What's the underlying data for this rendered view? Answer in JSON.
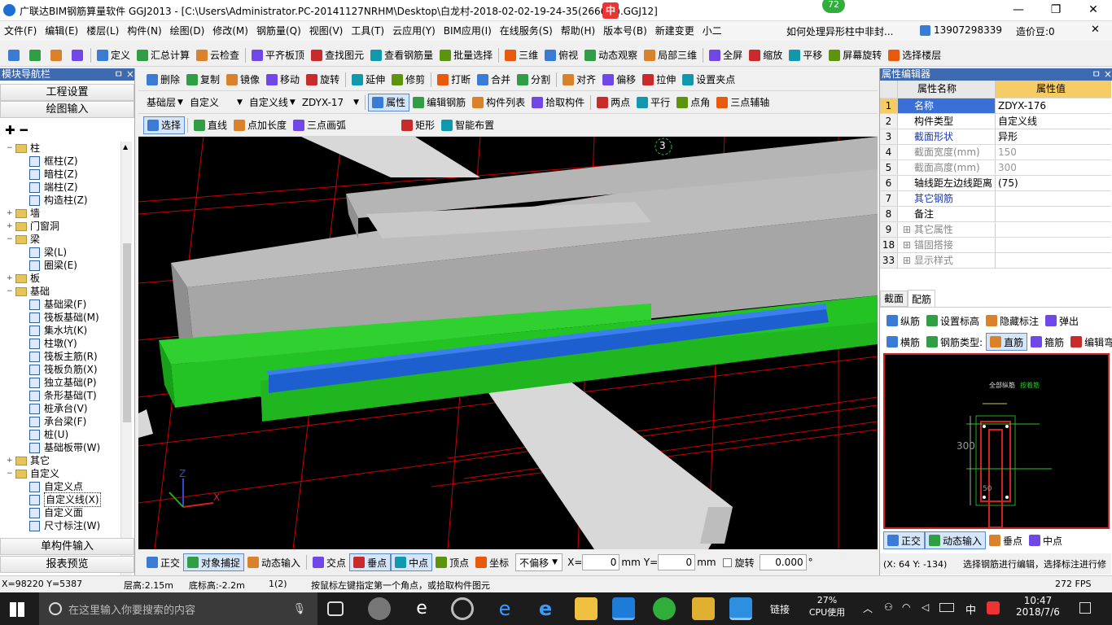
{
  "title": "广联达BIM钢筋算量软件 GGJ2013 - [C:\\Users\\Administrator.PC-20141127NRHM\\Desktop\\白龙村-2018-02-02-19-24-35(2666版).GGJ12]",
  "badge": "72",
  "ime": {
    "label": "中"
  },
  "menu": [
    "文件(F)",
    "编辑(E)",
    "楼层(L)",
    "构件(N)",
    "绘图(D)",
    "修改(M)",
    "钢筋量(Q)",
    "视图(V)",
    "工具(T)",
    "云应用(Y)",
    "BIM应用(I)",
    "在线服务(S)",
    "帮助(H)",
    "版本号(B)",
    "新建变更",
    "小二"
  ],
  "menu_right": {
    "question": "如何处理异形柱中非封...",
    "phone": "13907298339",
    "price": "造价豆:0"
  },
  "toolbar1": [
    "定义",
    "汇总计算",
    "云检查",
    "平齐板顶",
    "查找图元",
    "查看钢筋量",
    "批量选择",
    "三维",
    "俯视",
    "动态观察",
    "局部三维",
    "全屏",
    "缩放",
    "平移",
    "屏幕旋转",
    "选择楼层"
  ],
  "toolbar2": [
    "删除",
    "复制",
    "镜像",
    "移动",
    "旋转",
    "延伸",
    "修剪",
    "打断",
    "合并",
    "分割",
    "对齐",
    "偏移",
    "拉伸",
    "设置夹点"
  ],
  "toolbar3": {
    "layer": "基础层",
    "type": "自定义",
    "subtype": "自定义线",
    "component": "ZDYX-17",
    "buttons": [
      "属性",
      "编辑钢筋",
      "构件列表",
      "拾取构件",
      "两点",
      "平行",
      "点角",
      "三点辅轴"
    ]
  },
  "toolbar4": [
    "选择",
    "直线",
    "点加长度",
    "三点画弧",
    "矩形",
    "智能布置"
  ],
  "left": {
    "header": "模块导航栏",
    "pin": "ㅁ ×",
    "btn1": "工程设置",
    "btn2": "绘图输入",
    "tree": [
      {
        "level": 0,
        "exp": "−",
        "kind": "folder",
        "label": "柱"
      },
      {
        "level": 1,
        "kind": "leaf",
        "label": "框柱(Z)"
      },
      {
        "level": 1,
        "kind": "leaf",
        "label": "暗柱(Z)"
      },
      {
        "level": 1,
        "kind": "leaf",
        "label": "端柱(Z)"
      },
      {
        "level": 1,
        "kind": "leaf",
        "label": "构造柱(Z)"
      },
      {
        "level": 0,
        "exp": "+",
        "kind": "folder",
        "label": "墙"
      },
      {
        "level": 0,
        "exp": "+",
        "kind": "folder",
        "label": "门窗洞"
      },
      {
        "level": 0,
        "exp": "−",
        "kind": "folder",
        "label": "梁"
      },
      {
        "level": 1,
        "kind": "leaf",
        "label": "梁(L)"
      },
      {
        "level": 1,
        "kind": "leaf",
        "label": "圈梁(E)"
      },
      {
        "level": 0,
        "exp": "+",
        "kind": "folder",
        "label": "板"
      },
      {
        "level": 0,
        "exp": "−",
        "kind": "folder",
        "label": "基础"
      },
      {
        "level": 1,
        "kind": "leaf",
        "label": "基础梁(F)"
      },
      {
        "level": 1,
        "kind": "leaf",
        "label": "筏板基础(M)"
      },
      {
        "level": 1,
        "kind": "leaf",
        "label": "集水坑(K)"
      },
      {
        "level": 1,
        "kind": "leaf",
        "label": "柱墩(Y)"
      },
      {
        "level": 1,
        "kind": "leaf",
        "label": "筏板主筋(R)"
      },
      {
        "level": 1,
        "kind": "leaf",
        "label": "筏板负筋(X)"
      },
      {
        "level": 1,
        "kind": "leaf",
        "label": "独立基础(P)"
      },
      {
        "level": 1,
        "kind": "leaf",
        "label": "条形基础(T)"
      },
      {
        "level": 1,
        "kind": "leaf",
        "label": "桩承台(V)"
      },
      {
        "level": 1,
        "kind": "leaf",
        "label": "承台梁(F)"
      },
      {
        "level": 1,
        "kind": "leaf",
        "label": "桩(U)"
      },
      {
        "level": 1,
        "kind": "leaf",
        "label": "基础板带(W)"
      },
      {
        "level": 0,
        "exp": "+",
        "kind": "folder",
        "label": "其它"
      },
      {
        "level": 0,
        "exp": "−",
        "kind": "folder",
        "label": "自定义"
      },
      {
        "level": 1,
        "kind": "leaf",
        "label": "自定义点"
      },
      {
        "level": 1,
        "kind": "leaf",
        "label": "自定义线(X)",
        "selected": true
      },
      {
        "level": 1,
        "kind": "leaf",
        "label": "自定义面"
      },
      {
        "level": 1,
        "kind": "leaf",
        "label": "尺寸标注(W)"
      }
    ],
    "btn3": "单构件输入",
    "btn4": "报表预览"
  },
  "canvas": {
    "marker": "3"
  },
  "props": {
    "header": "属性编辑器",
    "col_name": "属性名称",
    "col_value": "属性值",
    "rows": [
      {
        "n": "1",
        "name": "名称",
        "value": "ZDYX-176",
        "blue": true
      },
      {
        "n": "2",
        "name": "构件类型",
        "value": "自定义线"
      },
      {
        "n": "3",
        "name": "截面形状",
        "value": "异形",
        "blue": true
      },
      {
        "n": "4",
        "name": "截面宽度(mm)",
        "value": "150",
        "gray": true
      },
      {
        "n": "5",
        "name": "截面高度(mm)",
        "value": "300",
        "gray": true
      },
      {
        "n": "6",
        "name": "轴线距左边线距离",
        "value": "(75)"
      },
      {
        "n": "7",
        "name": "其它钢筋",
        "value": "",
        "blue": true
      },
      {
        "n": "8",
        "name": "备注",
        "value": ""
      },
      {
        "n": "9",
        "name": "其它属性",
        "value": "",
        "exp": true
      },
      {
        "n": "18",
        "name": "锚固搭接",
        "value": "",
        "exp": true
      },
      {
        "n": "33",
        "name": "显示样式",
        "value": "",
        "exp": true
      }
    ]
  },
  "rebar": {
    "tabs": [
      "截面",
      "配筋"
    ],
    "row1": [
      "纵筋",
      "设置标高",
      "隐藏标注",
      "弹出"
    ],
    "row2": [
      "横筋",
      "钢筋类型:",
      "直筋",
      "箍筋",
      "编辑弯钩"
    ],
    "drawing_labels": [
      "全部纵筋",
      "按着筋",
      "300",
      "50"
    ],
    "snap": [
      "正交",
      "动态输入",
      "垂点",
      "中点"
    ],
    "coords": "(X: 64 Y: -134)",
    "hint": "选择钢筋进行编辑，选择标注进行修"
  },
  "bottom": {
    "buttons": [
      "正交",
      "对象捕捉",
      "动态输入",
      "交点",
      "垂点",
      "中点",
      "顶点",
      "坐标"
    ],
    "offset": "不偏移",
    "x_label": "X=",
    "x_value": "0",
    "y_label": "Y=",
    "y_value": "0",
    "unit": "mm",
    "rotate": "旋转",
    "rot_value": "0.000",
    "deg": "°"
  },
  "status": {
    "xy": "X=98220 Y=5387",
    "floor_h": "层高:2.15m",
    "base_h": "底标高:-2.2m",
    "count": "1(2)",
    "msg": "按鼠标左键指定第一个角点，或拾取构件图元",
    "fps": "272 FPS"
  },
  "taskbar": {
    "search": "在这里输入你要搜索的内容",
    "link": "链接",
    "cpu_pct": "27%",
    "cpu_label": "CPU使用",
    "ime": "中",
    "time": "10:47",
    "date": "2018/7/6"
  },
  "colors": {
    "green": "#22cc22",
    "blue": "#1e5fd0",
    "gray": "#a6a6a6",
    "red": "#cc0000",
    "accent": "#3f6ab0"
  }
}
